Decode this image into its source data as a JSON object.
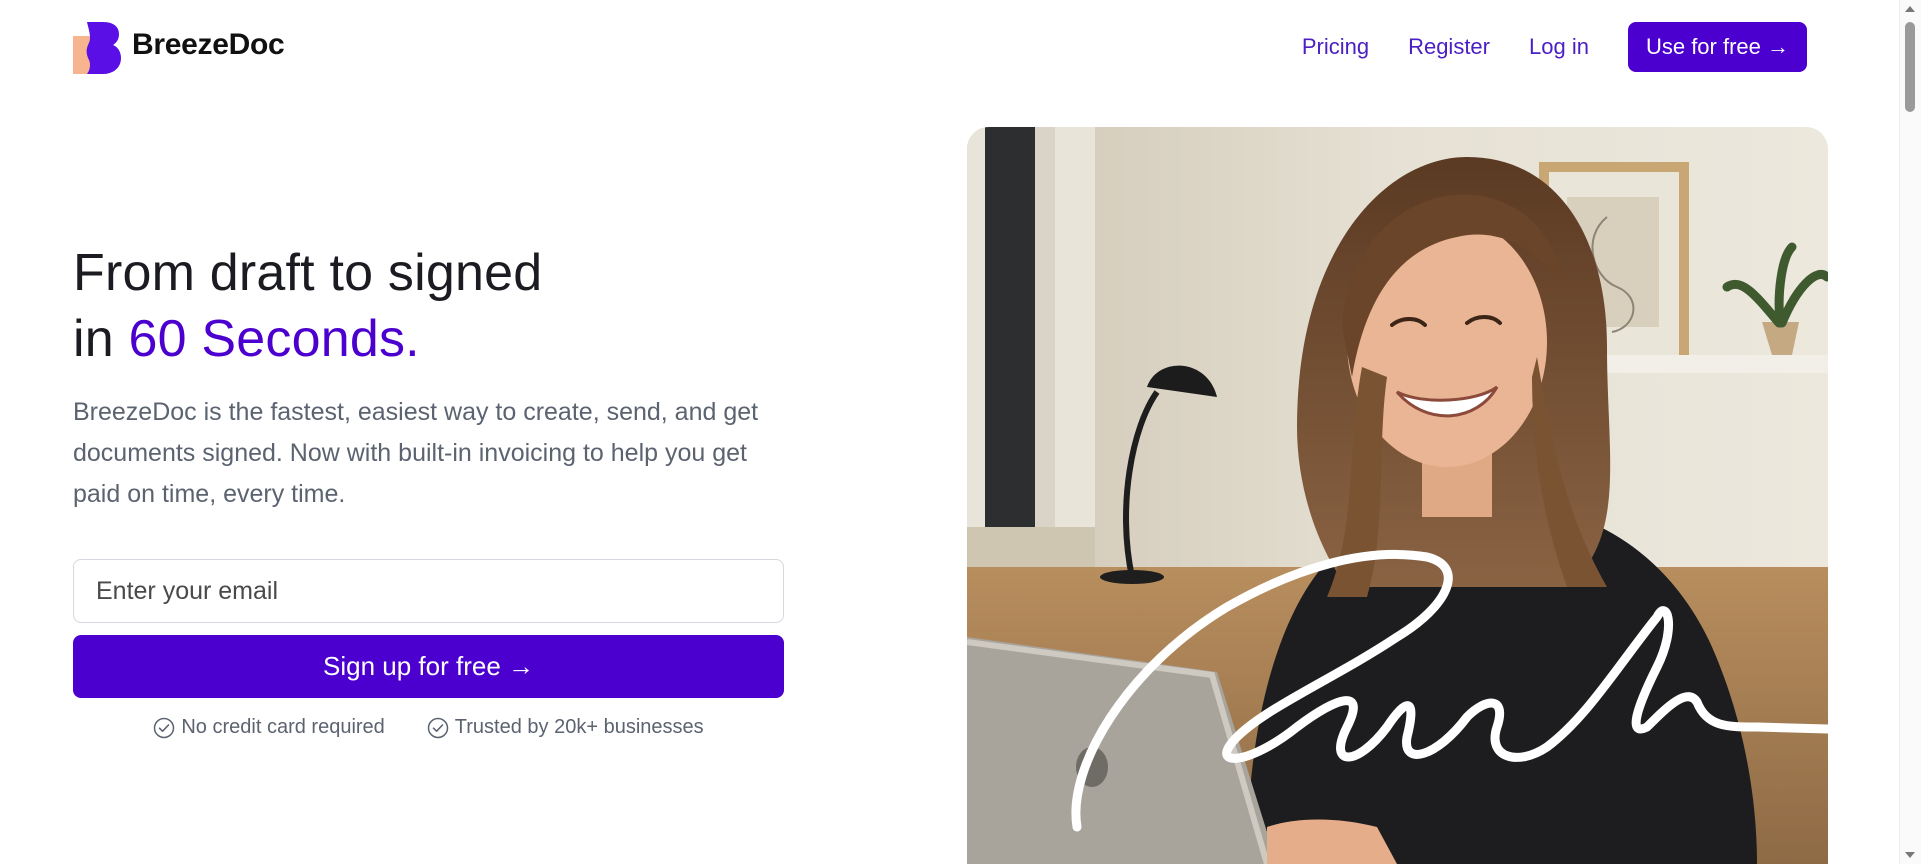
{
  "header": {
    "brand": "BreezeDoc",
    "nav": [
      "Pricing",
      "Register",
      "Log in"
    ],
    "cta": "Use for free →"
  },
  "hero": {
    "title_line1": "From draft to signed",
    "title_line2_prefix": "in ",
    "title_line2_accent": "60 Seconds.",
    "description": "BreezeDoc is the fastest, easiest way to create, send, and get documents signed. Now with built-in invoicing to help you get paid on time, every time.",
    "email_placeholder": "Enter your email",
    "signup_label": "Sign up for free →",
    "trust": [
      "No credit card required",
      "Trusted by 20k+ businesses"
    ]
  },
  "colors": {
    "accent": "#4b00cf",
    "logo_peach": "#f7b48e",
    "text_muted": "#5c6370"
  }
}
